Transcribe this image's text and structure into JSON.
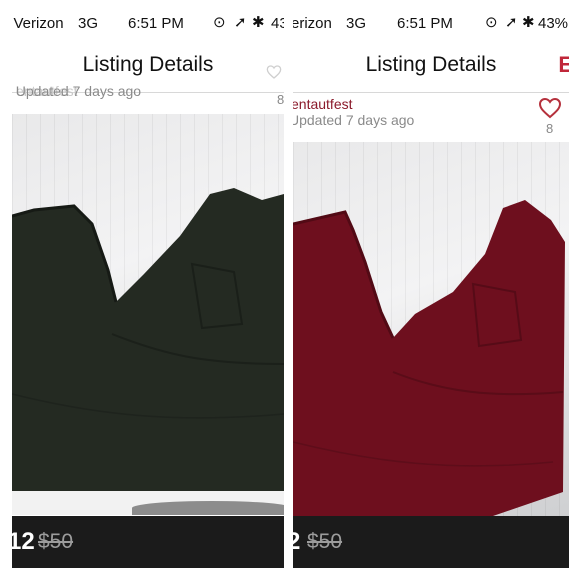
{
  "left": {
    "status": {
      "carrier": "Verizon",
      "network": "3G",
      "time": "6:51 PM",
      "battery": "43"
    },
    "nav": {
      "title": "Listing Details"
    },
    "seller": {
      "username": "entautfest",
      "updated": "Updated 7 days ago"
    },
    "likes": "8",
    "price": {
      "current": "12",
      "original": "$50"
    },
    "colors": {
      "pants": "#242a22"
    }
  },
  "right": {
    "status": {
      "carrier": "erizon",
      "network": "3G",
      "time": "6:51 PM",
      "battery": "43%"
    },
    "nav": {
      "title": "Listing Details",
      "action": "E"
    },
    "seller": {
      "username": "entautfest",
      "updated": "Updated 7 days ago"
    },
    "likes": "8",
    "price": {
      "current": "2",
      "original": "$50"
    },
    "colors": {
      "pants": "#6e0f1e",
      "heart": "#b5303c"
    }
  }
}
